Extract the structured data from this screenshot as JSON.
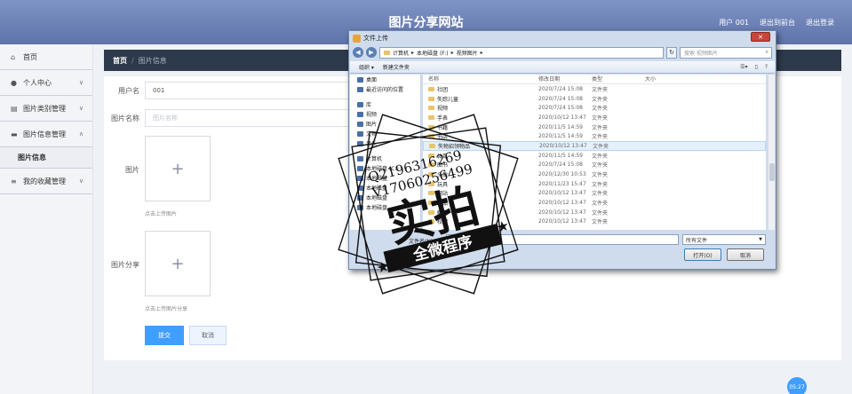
{
  "header": {
    "title": "图片分享网站",
    "links": [
      "用户 001",
      "退出到前台",
      "退出登录"
    ]
  },
  "sidebar": {
    "items": [
      {
        "label": "首页",
        "icon": "home-icon"
      },
      {
        "label": "个人中心",
        "icon": "user-icon"
      },
      {
        "label": "图片类别管理",
        "icon": "category-icon"
      },
      {
        "label": "图片信息管理",
        "icon": "image-manage-icon"
      },
      {
        "label": "我的收藏管理",
        "icon": "favorite-icon"
      }
    ],
    "sub_item": "图片信息"
  },
  "breadcrumb": {
    "home": "首页",
    "separator": "/",
    "current": "图片信息"
  },
  "form": {
    "username_label": "用户名",
    "username_value": "001",
    "image_name_label": "图片名称",
    "image_name_placeholder": "图片名称",
    "image_label": "图片",
    "image_hint": "点击上传图片",
    "share_label": "图片分享",
    "share_hint": "点击上传图片分享",
    "submit_label": "提交",
    "cancel_label": "取消",
    "plus": "+"
  },
  "time_badge": "05:27",
  "dialog": {
    "title": "文件上传",
    "close": "✕",
    "path": [
      "计算机",
      "本地磁盘 (F:)",
      "视频图片"
    ],
    "search_placeholder": "搜索 视频图片",
    "organize": "组织 ▾",
    "new_folder": "新建文件夹",
    "nav": [
      {
        "label": "桌面",
        "gap": false
      },
      {
        "label": "最近访问的位置",
        "gap": false
      },
      {
        "label": "库",
        "gap": true
      },
      {
        "label": "视频",
        "gap": false
      },
      {
        "label": "图片",
        "gap": false
      },
      {
        "label": "文档",
        "gap": false
      },
      {
        "label": "音乐",
        "gap": false
      },
      {
        "label": "计算机",
        "gap": true
      },
      {
        "label": "本地磁盘 (C:)",
        "gap": false
      },
      {
        "label": "本地磁盘",
        "gap": false
      },
      {
        "label": "本地磁盘",
        "gap": false
      },
      {
        "label": "本地磁盘",
        "gap": false
      },
      {
        "label": "本地磁盘",
        "gap": false
      }
    ],
    "columns": [
      "名称",
      "修改日期",
      "类型",
      "大小"
    ],
    "files": [
      {
        "name": "社团",
        "date": "2020/7/24 15:08",
        "type": "文件夹"
      },
      {
        "name": "失踪儿童",
        "date": "2020/7/24 15:08",
        "type": "文件夹"
      },
      {
        "name": "视频",
        "date": "2020/7/24 15:08",
        "type": "文件夹"
      },
      {
        "name": "手表",
        "date": "2020/10/12 13:47",
        "type": "文件夹"
      },
      {
        "name": "书籍",
        "date": "2020/11/5 14:59",
        "type": "文件夹"
      },
      {
        "name": "书店",
        "date": "2020/11/5 14:59",
        "type": "文件夹"
      },
      {
        "name": "失物招领物品",
        "date": "2020/10/12 13:47",
        "type": "文件夹"
      },
      {
        "name": "体育",
        "date": "2020/11/5 14:59",
        "type": "文件夹"
      },
      {
        "name": "图书",
        "date": "2020/7/24 15:08",
        "type": "文件夹"
      },
      {
        "name": "头像",
        "date": "2020/12/30 10:53",
        "type": "文件夹"
      },
      {
        "name": "玩具",
        "date": "2020/11/23 15:47",
        "type": "文件夹"
      },
      {
        "name": "网站",
        "date": "2020/10/12 13:47",
        "type": "文件夹"
      },
      {
        "name": "物品",
        "date": "2020/10/12 13:47",
        "type": "文件夹"
      },
      {
        "name": "鲜花",
        "date": "2020/10/12 13:47",
        "type": "文件夹"
      },
      {
        "name": "校园",
        "date": "2020/10/12 13:47",
        "type": "文件夹"
      }
    ],
    "filename_label": "文件名(N):",
    "filetype": "所有文件",
    "open_label": "打开(O)",
    "cancel_label": "取消"
  },
  "watermark": {
    "line1": "Q2196316269",
    "line2": "V17060256499",
    "big": "实拍",
    "banner": "全微程序"
  }
}
